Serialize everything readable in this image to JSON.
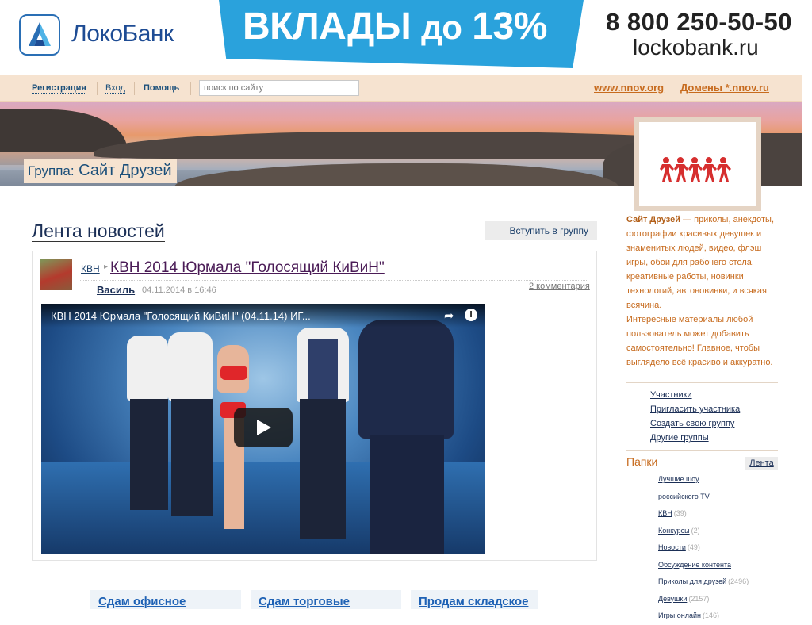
{
  "banner": {
    "logo_text": "ЛокоБанк",
    "promo_main": "ВКЛАДЫ",
    "promo_mid": "до",
    "promo_rate": "13%",
    "phone": "8 800 250-50-50",
    "site": "lockobank.ru",
    "colors": {
      "logo_blue": "#1e4c94",
      "promo_bg": "#2aa2dc"
    }
  },
  "nav": {
    "register": "Регистрация",
    "login": "Вход",
    "help": "Помощь",
    "search_placeholder": "поиск по сайту",
    "link_nnov": "www.nnov.org",
    "link_domains": "Домены *.nnov.ru",
    "colors": {
      "bar_bg": "#f6e3d0",
      "right_links": "#c76b1e"
    }
  },
  "hero": {
    "group_prefix": "Группа:",
    "group_name": "Сайт Друзей"
  },
  "main": {
    "feed_title": "Лента новостей",
    "join_button": "Вступить в группу",
    "post": {
      "category": "КВН",
      "title": "КВН 2014 Юрмала \"Голосящий КиВиН\"",
      "author": "Василь",
      "date": "04.11.2014 в 16:46",
      "comments": "2 комментария",
      "video_title": "КВН 2014 Юрмала \"Голосящий КиВиН\" (04.11.14) ИГ...",
      "share_icon": "share-icon",
      "info_icon": "info-icon",
      "play_icon": "play-icon"
    }
  },
  "ads": [
    "Сдам офисное",
    "Сдам торговые",
    "Продам складское"
  ],
  "sidebar": {
    "desc_name": "Сайт Друзей",
    "desc_rest": " — приколы, анекдоты, фотографии красивых девушек и знаменитых людей, видео, флэш игры, обои для рабочего стола, креативные работы, новинки технологий, автоновинки, и всякая всячина.",
    "desc2": "Интересные материалы любой пользователь может добавить самостоятельно! Главное, чтобы выглядело всё красиво и аккуратно.",
    "links": [
      "Участники",
      "Пригласить участника",
      "Создать свою группу",
      "Другие группы"
    ],
    "folders_title": "Папки",
    "feed_button": "Лента",
    "folders": [
      {
        "name": "Лучшие шоу",
        "count": ""
      },
      {
        "name": "российского TV",
        "count": ""
      },
      {
        "name": "КВН",
        "count": "(39)"
      },
      {
        "name": "Конкурсы",
        "count": "(2)"
      },
      {
        "name": "Новости",
        "count": "(49)"
      },
      {
        "name": "Обсуждение контента",
        "count": ""
      },
      {
        "name": "Приколы для друзей",
        "count": "(2496)"
      },
      {
        "name": "Девушки",
        "count": "(2157)"
      },
      {
        "name": "Игры онлайн",
        "count": "(146)"
      }
    ]
  }
}
